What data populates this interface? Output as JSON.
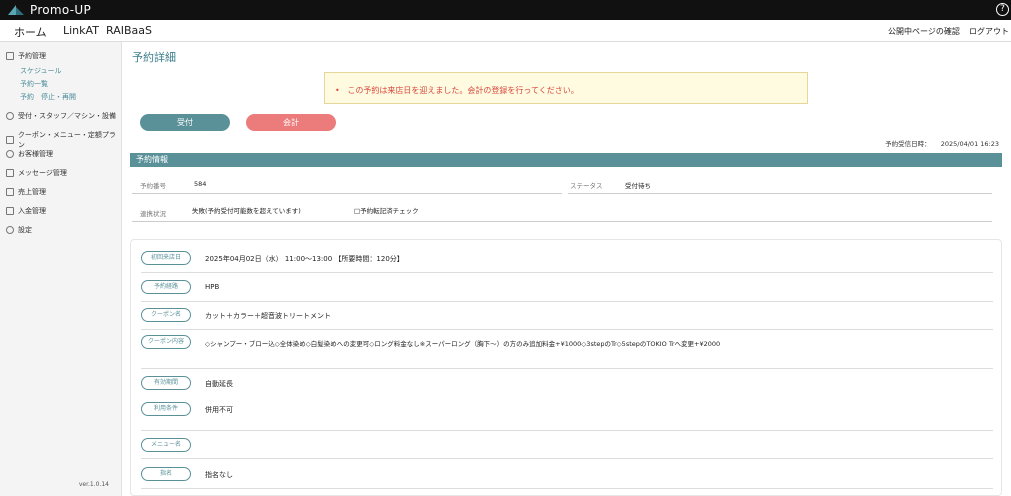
{
  "app": {
    "title": "Promo-UP",
    "help_glyph": "?"
  },
  "nav": {
    "tabs": [
      {
        "label": "ホーム"
      },
      {
        "label": "LinkAT"
      },
      {
        "label": "RAIBaaS"
      }
    ],
    "right_links": [
      {
        "label": "公開中ページの確認"
      },
      {
        "label": "ログアウト"
      }
    ]
  },
  "sidebar": {
    "items": [
      {
        "label": "予約管理",
        "icon": "calendar-icon"
      },
      {
        "label": "受付・スタッフ／マシン・設備",
        "icon": "person-icon"
      },
      {
        "label": "クーポン・メニュー・定額プラン",
        "icon": "ticket-icon"
      },
      {
        "label": "お客様管理",
        "icon": "users-icon"
      },
      {
        "label": "メッセージ管理",
        "icon": "message-icon"
      },
      {
        "label": "売上管理",
        "icon": "chart-icon"
      },
      {
        "label": "入金管理",
        "icon": "wallet-icon"
      },
      {
        "label": "設定",
        "icon": "gear-icon"
      }
    ],
    "sub_items": [
      {
        "label": "スケジュール"
      },
      {
        "label": "予約一覧"
      },
      {
        "label": "予約　停止・再開"
      }
    ],
    "version": "ver.1.0.14"
  },
  "page": {
    "title": "予約詳細",
    "alert": "この予約は来店日を迎えました。会計の登録を行ってください。",
    "buttons": {
      "reception": "受付",
      "checkout": "会計"
    },
    "received_label": "予約受信日時：",
    "received_value": "2025/04/01 16:23",
    "section_title": "予約情報",
    "info": {
      "reservation_no_label": "予約番号",
      "reservation_no": "584",
      "status_label": "ステータス",
      "status": "受付待ち",
      "link_label": "連携状況",
      "link_value": "失敗(予約受付可能数を超えています)",
      "link_check": "□予約転記済チェック"
    },
    "details": [
      {
        "label": "初回来店日",
        "value": "2025年04月02日（水） 11:00〜13:00 【所要時間：120分】"
      },
      {
        "label": "予約経路",
        "value": "HPB"
      },
      {
        "label": "クーポン名",
        "value": "カット＋カラー＋超音波トリートメント"
      },
      {
        "label": "クーポン内容",
        "value": "◇シャンプー・ブロー込◇全体染め◇白髪染めへの変更可◇ロング料金なし※スーパーロング（胸下〜）の方のみ追加料金+¥1000◇3stepのTr◇5stepのTOKIO Trへ変更+¥2000"
      },
      {
        "label": "有効期間",
        "value": "自動延長"
      },
      {
        "label": "利用条件",
        "value": "併用不可"
      },
      {
        "label": "メニュー名",
        "value": ""
      },
      {
        "label": "指名",
        "value": "指名なし"
      }
    ]
  }
}
